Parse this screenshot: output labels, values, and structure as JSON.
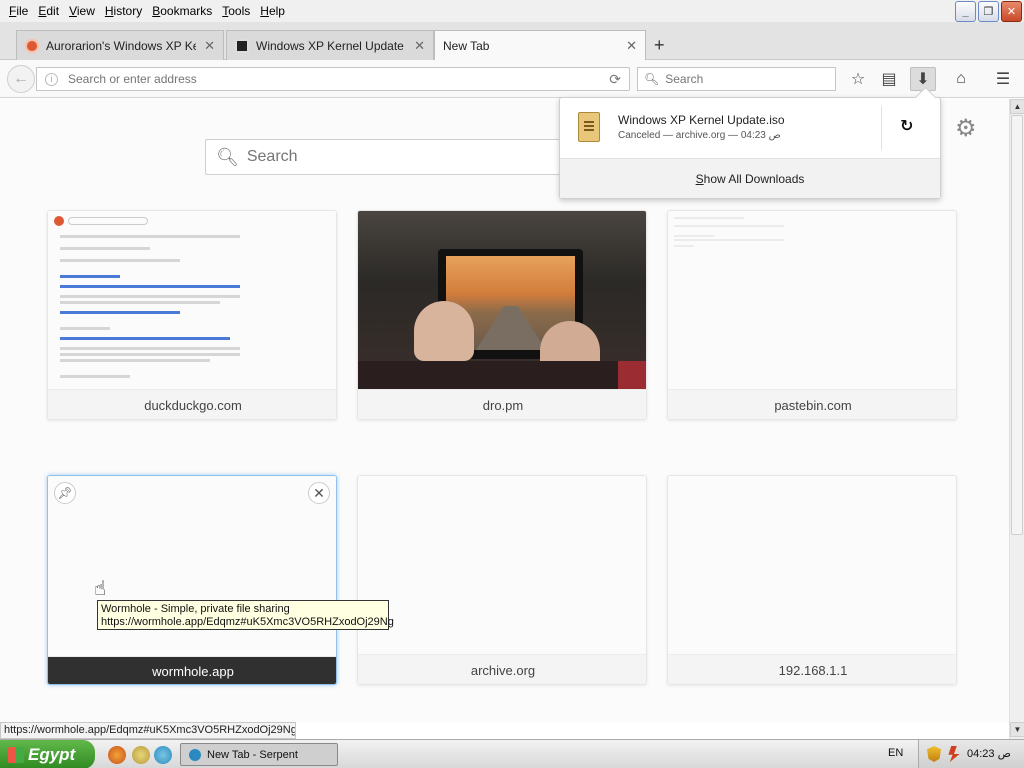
{
  "menubar": {
    "items": [
      "File",
      "Edit",
      "View",
      "History",
      "Bookmarks",
      "Tools",
      "Help"
    ]
  },
  "tabs": [
    {
      "title": "Aurorarion's Windows XP Kernel",
      "favicon": "duckduckgo-icon"
    },
    {
      "title": "Windows XP Kernel Update : Fr",
      "favicon": "archive-icon"
    },
    {
      "title": "New Tab",
      "active": true
    }
  ],
  "navbar": {
    "url_placeholder": "Search or enter address",
    "search_placeholder": "Search"
  },
  "newtab": {
    "search_placeholder": "Search",
    "tiles_row1": [
      {
        "label": "duckduckgo.com"
      },
      {
        "label": "dro.pm"
      },
      {
        "label": "pastebin.com"
      }
    ],
    "tiles_row2": [
      {
        "label": "wormhole.app"
      },
      {
        "label": "archive.org"
      },
      {
        "label": "192.168.1.1"
      }
    ]
  },
  "downloads": {
    "file_name": "Windows XP Kernel Update.iso",
    "status": "Canceled — archive.org — 04:23 ص",
    "show_all": "Show All Downloads"
  },
  "tooltip": {
    "line1": "Wormhole - Simple, private file sharing",
    "line2": "https://wormhole.app/Edqmz#uK5Xmc3VO5RHZxodOj29Ng"
  },
  "status_link": "https://wormhole.app/Edqmz#uK5Xmc3VO5RHZxodOj29Ng",
  "taskbar": {
    "start_label": "Egypt",
    "task_label": "New Tab - Serpent",
    "language": "EN",
    "clock": "04:23 ص"
  },
  "colors": {
    "start_green": "#3a9a2a",
    "tooltip_bg": "#ffffe1",
    "hover_label_bg": "#303030"
  }
}
